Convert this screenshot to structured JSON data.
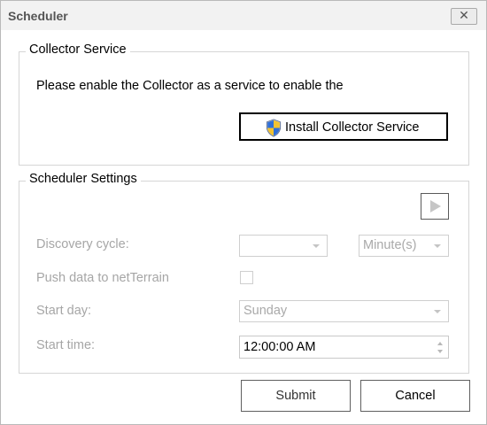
{
  "window": {
    "title": "Scheduler",
    "close_label": "✕"
  },
  "collector": {
    "group_title": "Collector Service",
    "message": "Please enable the Collector as a service to enable the",
    "install_label": "Install Collector Service"
  },
  "scheduler": {
    "group_title": "Scheduler Settings",
    "discovery_label": "Discovery cycle:",
    "discovery_value": "",
    "unit_value": "Minute(s)",
    "push_label": "Push data to netTerrain",
    "push_checked": false,
    "start_day_label": "Start day:",
    "start_day_value": "Sunday",
    "start_time_label": "Start time:",
    "start_time_value": "12:00:00 AM"
  },
  "footer": {
    "submit_label": "Submit",
    "cancel_label": "Cancel"
  },
  "colors": {
    "disabled_text": "#a6a6a6",
    "border": "#d6d6d6",
    "titlebar": "#f2f2f2"
  },
  "icons": {
    "install": "uac-shield-icon",
    "play": "play-icon",
    "close": "close-icon"
  }
}
